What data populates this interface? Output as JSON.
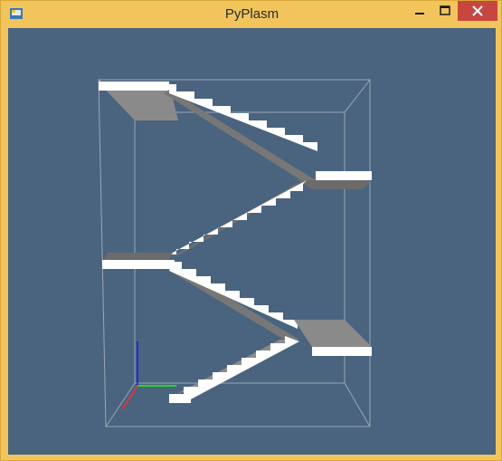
{
  "window": {
    "title": "PyPlasm",
    "icons": {
      "app": "pyplasm-app-icon",
      "minimize": "minimize-icon",
      "maximize": "maximize-icon",
      "close": "close-icon"
    }
  },
  "viewport": {
    "background": "#4a637f",
    "axis_colors": {
      "x": "#d23a3a",
      "y": "#2fd12f",
      "z": "#1e2fd8"
    }
  }
}
